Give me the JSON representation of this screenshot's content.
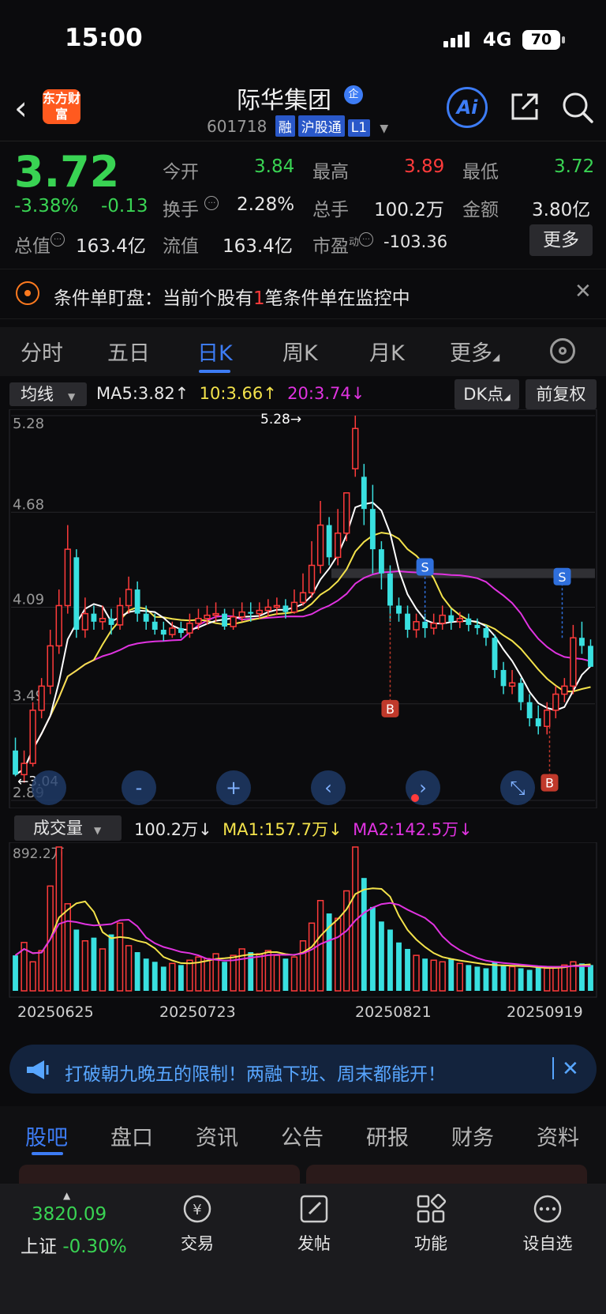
{
  "status": {
    "time": "15:00",
    "network": "4G",
    "battery": "70"
  },
  "header": {
    "logo": "东方财富",
    "title": "际华集团",
    "badge": "企",
    "code": "601718",
    "tags": [
      "融",
      "沪股通",
      "L1"
    ],
    "ai_label": "Ai"
  },
  "quote": {
    "price": "3.72",
    "pct": "-3.38%",
    "change": "-0.13",
    "fields": [
      {
        "label": "今开",
        "value": "3.84",
        "color": "#39d353"
      },
      {
        "label": "最高",
        "value": "3.89",
        "color": "#ff3b3b"
      },
      {
        "label": "最低",
        "value": "3.72",
        "color": "#39d353"
      },
      {
        "label": "换手",
        "value": "2.28%",
        "color": "#e6e6e6"
      },
      {
        "label": "总手",
        "value": "100.2万",
        "color": "#e6e6e6"
      },
      {
        "label": "金额",
        "value": "3.80亿",
        "color": "#e6e6e6"
      },
      {
        "label": "总值",
        "value": "163.4亿",
        "color": "#e6e6e6"
      },
      {
        "label": "流值",
        "value": "163.4亿",
        "color": "#e6e6e6"
      },
      {
        "label": "市盈",
        "value": "-103.36",
        "color": "#e6e6e6"
      }
    ],
    "pe_sup": "动",
    "more": "更多"
  },
  "banner": {
    "prefix": "条件单盯盘：当前个股有",
    "count": "1",
    "suffix": "笔条件单在监控中"
  },
  "tabs": [
    "分时",
    "五日",
    "日K",
    "周K",
    "月K",
    "更多"
  ],
  "chart": {
    "ma_selector": "均线",
    "ma5": "MA5:3.82↑",
    "ma10": "10:3.66↑",
    "ma20": "20:3.74↓",
    "dk_button": "DK点",
    "adjust_button": "前复权",
    "y_labels": [
      "5.28",
      "4.68",
      "4.09",
      "3.49",
      "2.89"
    ],
    "high_marker": "5.28→",
    "low_marker": "←3.04",
    "vol_selector": "成交量",
    "vol": "100.2万↓",
    "vol_ma1": "MA1:157.7万↓",
    "vol_ma2": "MA2:142.5万↓",
    "vol_max": "892.2万",
    "dates": [
      "20250625",
      "20250723",
      "20250821",
      "20250919"
    ],
    "signal_b": "B",
    "signal_s": "S"
  },
  "chart_data": {
    "type": "candlestick",
    "y_range": [
      2.89,
      5.28
    ],
    "colors": {
      "up": "#ff3b3b",
      "down": "#39e0e0",
      "ma5": "#ffffff",
      "ma10": "#f3e24b",
      "ma20": "#e033e0"
    },
    "candles": [
      [
        3.2,
        3.05,
        3.28,
        3.04
      ],
      [
        3.05,
        3.12,
        3.2,
        3.0
      ],
      [
        3.12,
        3.45,
        3.5,
        3.1
      ],
      [
        3.45,
        3.6,
        3.65,
        3.4
      ],
      [
        3.6,
        3.85,
        3.95,
        3.55
      ],
      [
        3.85,
        4.1,
        4.2,
        3.8
      ],
      [
        4.1,
        4.45,
        4.6,
        4.05
      ],
      [
        4.4,
        3.95,
        4.45,
        3.9
      ],
      [
        3.95,
        4.05,
        4.15,
        3.9
      ],
      [
        4.05,
        4.0,
        4.1,
        3.95
      ],
      [
        4.0,
        4.02,
        4.1,
        3.95
      ],
      [
        4.02,
        3.98,
        4.08,
        3.92
      ],
      [
        3.98,
        4.1,
        4.15,
        3.95
      ],
      [
        4.1,
        4.2,
        4.28,
        4.05
      ],
      [
        4.2,
        4.05,
        4.25,
        4.0
      ],
      [
        4.05,
        4.0,
        4.1,
        3.95
      ],
      [
        4.0,
        3.95,
        4.05,
        3.92
      ],
      [
        3.95,
        3.92,
        4.0,
        3.88
      ],
      [
        3.92,
        3.96,
        4.0,
        3.9
      ],
      [
        3.96,
        3.93,
        4.0,
        3.9
      ],
      [
        3.93,
        3.99,
        4.05,
        3.9
      ],
      [
        3.99,
        4.02,
        4.08,
        3.95
      ],
      [
        4.02,
        4.04,
        4.1,
        3.98
      ],
      [
        4.04,
        4.05,
        4.12,
        4.0
      ],
      [
        4.05,
        3.97,
        4.08,
        3.95
      ],
      [
        3.97,
        4.03,
        4.08,
        3.95
      ],
      [
        4.03,
        4.06,
        4.12,
        4.0
      ],
      [
        4.06,
        4.05,
        4.12,
        4.0
      ],
      [
        4.05,
        4.07,
        4.12,
        4.02
      ],
      [
        4.07,
        4.09,
        4.14,
        4.03
      ],
      [
        4.09,
        4.1,
        4.15,
        4.04
      ],
      [
        4.1,
        4.06,
        4.14,
        4.02
      ],
      [
        4.06,
        4.12,
        4.2,
        4.05
      ],
      [
        4.12,
        4.18,
        4.3,
        4.1
      ],
      [
        4.18,
        4.35,
        4.5,
        4.15
      ],
      [
        4.35,
        4.6,
        4.75,
        4.3
      ],
      [
        4.6,
        4.4,
        4.65,
        4.35
      ],
      [
        4.4,
        4.55,
        4.7,
        4.35
      ],
      [
        4.55,
        4.8,
        4.8,
        4.5
      ],
      [
        4.95,
        5.2,
        5.28,
        4.9
      ],
      [
        4.9,
        4.7,
        4.98,
        4.6
      ],
      [
        4.7,
        4.45,
        4.85,
        4.3
      ],
      [
        4.45,
        4.3,
        4.5,
        4.2
      ],
      [
        4.3,
        4.1,
        4.35,
        4.0
      ],
      [
        4.1,
        4.05,
        4.15,
        4.0
      ],
      [
        4.05,
        3.95,
        4.1,
        3.9
      ],
      [
        3.95,
        4.0,
        4.05,
        3.9
      ],
      [
        4.0,
        3.96,
        4.05,
        3.9
      ],
      [
        3.96,
        3.99,
        4.05,
        3.92
      ],
      [
        3.99,
        4.04,
        4.1,
        3.95
      ],
      [
        4.04,
        4.0,
        4.08,
        3.95
      ],
      [
        4.0,
        4.02,
        4.06,
        3.96
      ],
      [
        4.02,
        3.98,
        4.05,
        3.94
      ],
      [
        3.98,
        3.96,
        4.02,
        3.92
      ],
      [
        3.96,
        3.9,
        3.98,
        3.85
      ],
      [
        3.9,
        3.7,
        3.92,
        3.65
      ],
      [
        3.7,
        3.6,
        3.75,
        3.55
      ],
      [
        3.6,
        3.62,
        3.7,
        3.55
      ],
      [
        3.62,
        3.5,
        3.65,
        3.45
      ],
      [
        3.5,
        3.4,
        3.55,
        3.35
      ],
      [
        3.4,
        3.35,
        3.48,
        3.3
      ],
      [
        3.35,
        3.45,
        3.5,
        3.3
      ],
      [
        3.45,
        3.55,
        3.6,
        3.4
      ],
      [
        3.55,
        3.6,
        3.65,
        3.5
      ],
      [
        3.6,
        3.9,
        3.98,
        3.55
      ],
      [
        3.9,
        3.85,
        4.0,
        3.8
      ],
      [
        3.85,
        3.72,
        3.89,
        3.72
      ]
    ],
    "volumes": [
      220,
      300,
      180,
      250,
      650,
      892,
      540,
      380,
      310,
      330,
      260,
      350,
      420,
      280,
      240,
      200,
      180,
      150,
      170,
      160,
      190,
      210,
      200,
      230,
      180,
      220,
      260,
      240,
      230,
      250,
      220,
      200,
      210,
      310,
      420,
      560,
      480,
      450,
      620,
      892,
      700,
      520,
      430,
      380,
      300,
      260,
      220,
      200,
      190,
      180,
      200,
      170,
      160,
      150,
      140,
      180,
      160,
      150,
      140,
      130,
      150,
      140,
      150,
      160,
      180,
      170,
      160
    ]
  },
  "ad": {
    "text": "打破朝九晚五的限制！两融下班、周末都能开！"
  },
  "bottom_tabs": [
    "股吧",
    "盘口",
    "资讯",
    "公告",
    "研报",
    "财务",
    "资料"
  ],
  "bottom_bar": {
    "index_value": "3820.09",
    "index_name": "上证",
    "index_change": "-0.30%",
    "nav": [
      "交易",
      "发帖",
      "功能",
      "设自选"
    ]
  }
}
